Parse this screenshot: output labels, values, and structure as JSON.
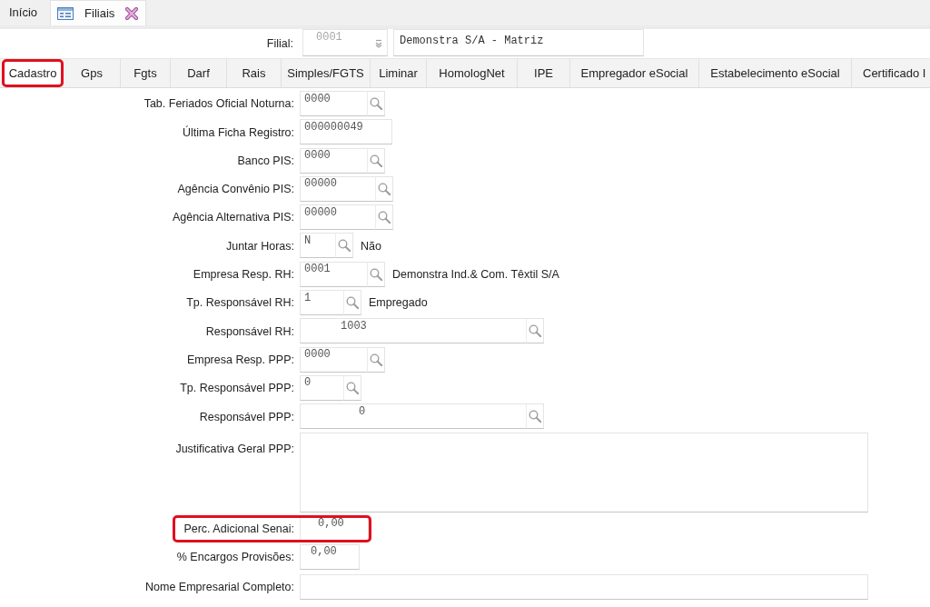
{
  "top_tabs": [
    {
      "kind": "home",
      "label": "Início",
      "selected": false
    },
    {
      "kind": "form",
      "label": "Filiais",
      "selected": true
    }
  ],
  "filial": {
    "label": "Filial:",
    "code": {
      "value": "0001",
      "disabled": true
    },
    "name": "Demonstra S/A - Matriz"
  },
  "tabs": [
    {
      "label": "Cadastro",
      "selected": true,
      "highlighted": true
    },
    {
      "label": "Gps",
      "selected": false,
      "highlighted": false
    },
    {
      "label": "Fgts",
      "selected": false,
      "highlighted": false
    },
    {
      "label": "Darf",
      "selected": false,
      "highlighted": false
    },
    {
      "label": "Rais",
      "selected": false,
      "highlighted": false
    },
    {
      "label": "Simples/FGTS",
      "selected": false,
      "highlighted": false
    },
    {
      "label": "Liminar",
      "selected": false,
      "highlighted": false
    },
    {
      "label": "HomologNet",
      "selected": false,
      "highlighted": false
    },
    {
      "label": "IPE",
      "selected": false,
      "highlighted": false
    },
    {
      "label": "Empregador eSocial",
      "selected": false,
      "highlighted": false
    },
    {
      "label": "Estabelecimento eSocial",
      "selected": false,
      "highlighted": false
    },
    {
      "label": "Certificado I",
      "selected": false,
      "highlighted": false
    }
  ],
  "fields": [
    {
      "kind": "lookup",
      "label": "Tab. Feriados Oficial Noturna:",
      "value": "0000",
      "highlighted": false
    },
    {
      "kind": "text",
      "label": "Última Ficha Registro:",
      "value": "000000049",
      "highlighted": false
    },
    {
      "kind": "lookup",
      "label": "Banco PIS:",
      "value": "0000",
      "highlighted": false
    },
    {
      "kind": "lookup",
      "label": "Agência Convênio PIS:",
      "value": "00000",
      "highlighted": false
    },
    {
      "kind": "lookup",
      "label": "Agência Alternativa PIS:",
      "value": "00000",
      "highlighted": false
    },
    {
      "kind": "lookup",
      "label": "Juntar Horas:",
      "value": "N",
      "description": "Não",
      "highlighted": false
    },
    {
      "kind": "lookup",
      "label": "Empresa Resp. RH:",
      "value": "0001",
      "description": "Demonstra Ind.& Com. Têxtil S/A",
      "highlighted": false
    },
    {
      "kind": "lookup",
      "label": "Tp. Responsável RH:",
      "value": "1",
      "description": "Empregado",
      "highlighted": false
    },
    {
      "kind": "lookup",
      "label": "Responsável RH:",
      "value": "1003",
      "highlighted": false
    },
    {
      "kind": "lookup",
      "label": "Empresa Resp. PPP:",
      "value": "0000",
      "highlighted": false
    },
    {
      "kind": "lookup",
      "label": "Tp. Responsável PPP:",
      "value": "0",
      "highlighted": false
    },
    {
      "kind": "lookup",
      "label": "Responsável PPP:",
      "value": "0",
      "highlighted": false
    },
    {
      "kind": "textarea",
      "label": "Justificativa Geral PPP:",
      "highlighted": false
    },
    {
      "kind": "text",
      "label": "Perc. Adicional Senai:",
      "value": "0,00",
      "highlighted": true
    },
    {
      "kind": "text",
      "label": "% Encargos Provisões:",
      "value": "0,00",
      "highlighted": false
    },
    {
      "kind": "text",
      "label": "Nome Empresarial Completo:",
      "highlighted": false
    }
  ]
}
